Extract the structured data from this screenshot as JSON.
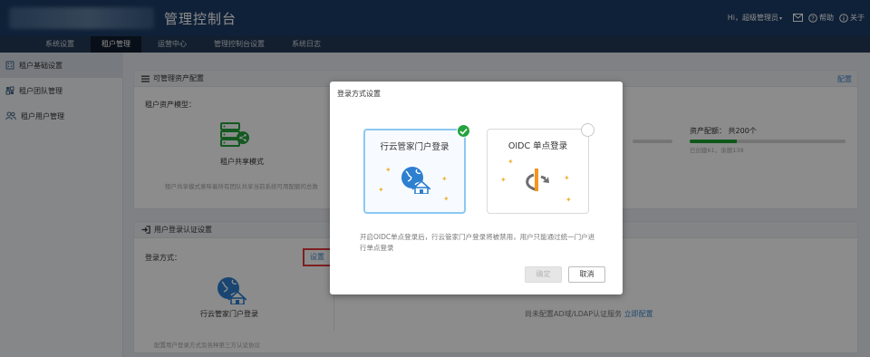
{
  "header": {
    "title": "管理控制台",
    "greeting": "Hi，超级管理员",
    "help_label": "帮助",
    "about_label": "关于"
  },
  "nav": {
    "tabs": [
      {
        "label": "系统设置"
      },
      {
        "label": "租户管理",
        "active": true
      },
      {
        "label": "运营中心"
      },
      {
        "label": "管理控制台设置"
      },
      {
        "label": "系统日志"
      }
    ]
  },
  "sidebar": {
    "items": [
      {
        "label": "租户基础设置",
        "icon": "building-icon",
        "active": true
      },
      {
        "label": "租户团队管理",
        "icon": "team-grid-icon"
      },
      {
        "label": "租户用户管理",
        "icon": "users-icon"
      }
    ]
  },
  "panel_assets": {
    "title": "可管理资产配置",
    "config_link": "配置",
    "model_label": "租户资产模型：",
    "model_name": "租户共享模式",
    "note": "租户共享模式意味着所有团队共享当前系统可用配额的总数",
    "quota_label": "资产配额：",
    "quota_total": "共200个",
    "quota_used_text": "已创建61，余额139",
    "quota_fraction": 0.305
  },
  "panel_login": {
    "title": "用户登录认证设置",
    "method_label": "登录方式：",
    "set_button": "设置",
    "method_name": "行云管家门户登录",
    "ad_note": "尚未配置AD域/LDAP认证服务",
    "ad_link": "立即配置",
    "footer_note": "配置用户登录方式及各种第三方认证协议"
  },
  "modal": {
    "title": "登录方式设置",
    "option_portal": "行云管家门户登录",
    "option_oidc": "OIDC 单点登录",
    "description": "开启OIDC单点登录后，行云管家门户登录将被禁用，用户只能通过统一门户进行单点登录",
    "ok_button": "确定",
    "cancel_button": "取消",
    "selected": "portal"
  },
  "colors": {
    "header_bg": "#1c3c66",
    "nav_bg": "#243a55",
    "accent_blue": "#3f85c8",
    "success_green": "#23a33d",
    "highlight_red": "#e4393c",
    "oidc_orange": "#f7941d"
  }
}
